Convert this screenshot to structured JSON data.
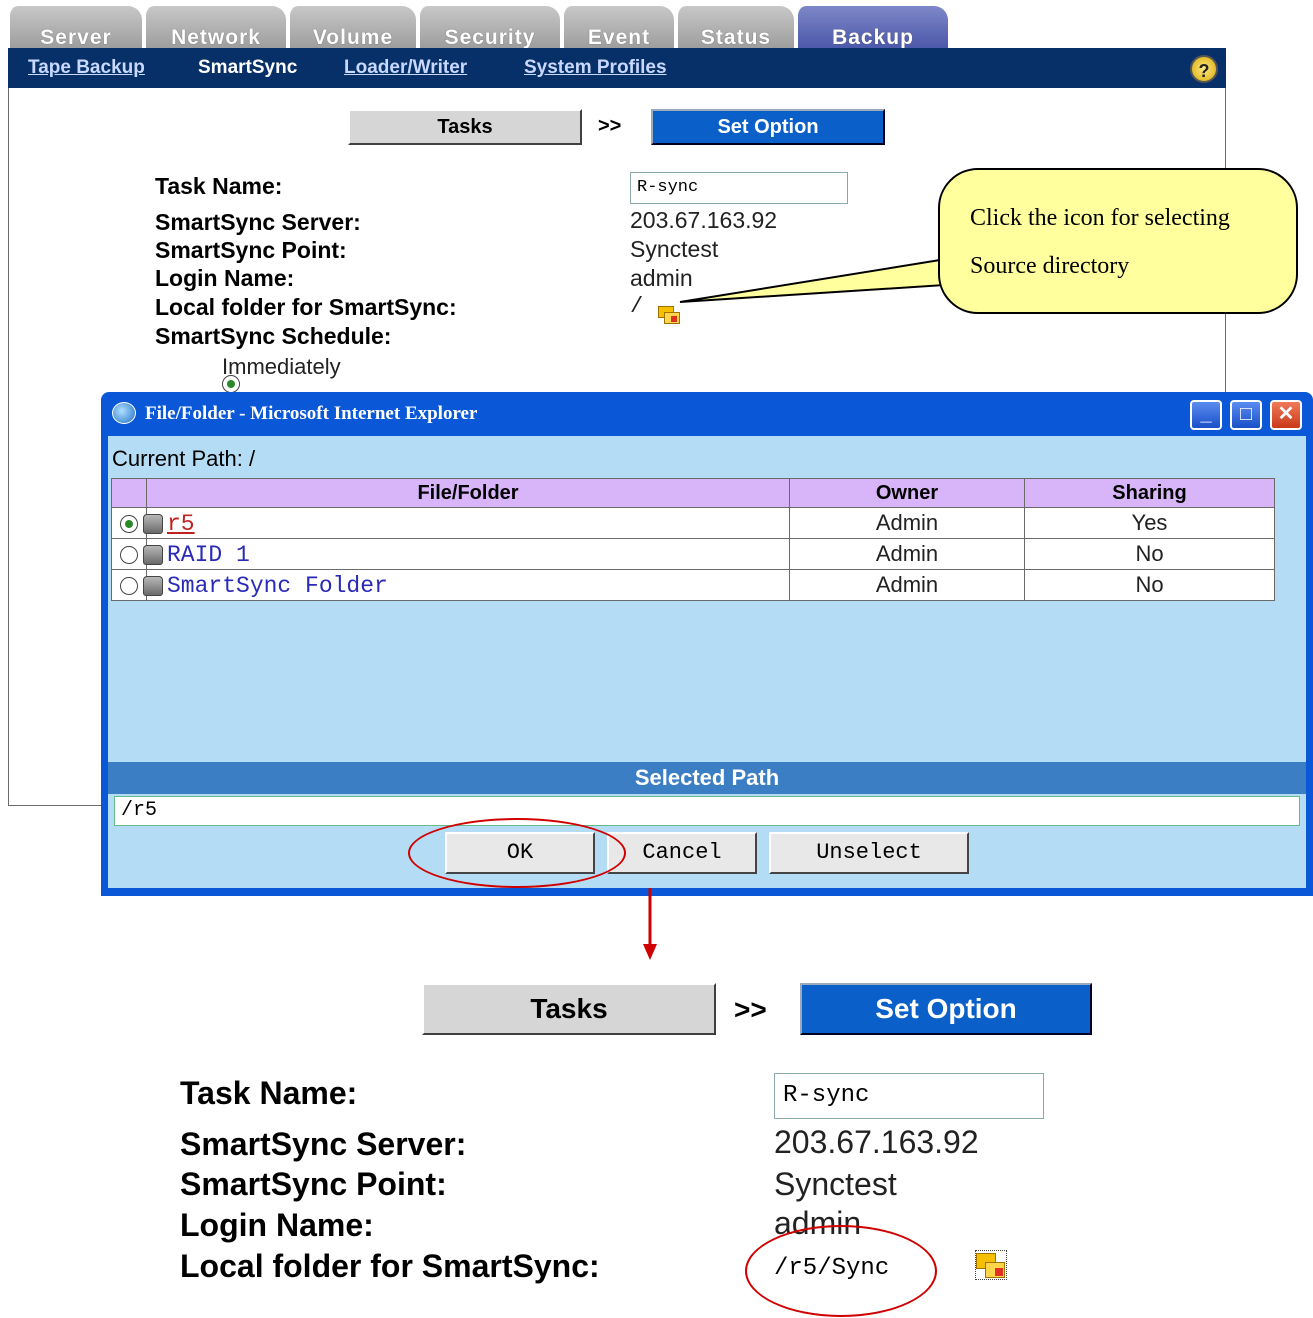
{
  "tabs": [
    "Server",
    "Network",
    "Volume",
    "Security",
    "Event",
    "Status",
    "Backup"
  ],
  "active_tab": "Backup",
  "subnav": [
    "Tape Backup",
    "SmartSync",
    "Loader/Writer",
    "System Profiles"
  ],
  "active_subnav": "SmartSync",
  "help_icon": "?",
  "steps": {
    "tasks": "Tasks",
    "arrow": ">>",
    "set_option": "Set Option"
  },
  "form": {
    "task_name_label": "Task Name:",
    "task_name_value": "R-sync",
    "server_label": "SmartSync Server:",
    "server_value": "203.67.163.92",
    "point_label": "SmartSync Point:",
    "point_value": "Synctest",
    "login_label": "Login Name:",
    "login_value": "admin",
    "local_label": "Local folder for SmartSync:",
    "local_value_before": "/",
    "local_value_after": "/r5/Sync",
    "schedule_label": "SmartSync Schedule:",
    "schedule_immediately": "Immediately"
  },
  "callout": {
    "line1": "Click the icon for selecting",
    "line2": "Source directory"
  },
  "dialog": {
    "title": "File/Folder - Microsoft Internet Explorer",
    "current_path": "Current Path: /",
    "columns": [
      "File/Folder",
      "Owner",
      "Sharing"
    ],
    "rows": [
      {
        "name": "r5",
        "owner": "Admin",
        "sharing": "Yes",
        "selected": true
      },
      {
        "name": "RAID 1",
        "owner": "Admin",
        "sharing": "No",
        "selected": false
      },
      {
        "name": "SmartSync Folder",
        "owner": "Admin",
        "sharing": "No",
        "selected": false
      }
    ],
    "selected_path_label": "Selected Path",
    "selected_path_value": "/r5",
    "ok": "OK",
    "cancel": "Cancel",
    "unselect": "Unselect"
  },
  "icons": {
    "folder": "folder-browse-icon",
    "help": "help-icon",
    "disk": "disk-icon"
  },
  "colors": {
    "accent_blue": "#0a5fc8",
    "nav_dark": "#083068",
    "callout_yellow": "#ffff9e",
    "annotation_red": "#d00000"
  }
}
